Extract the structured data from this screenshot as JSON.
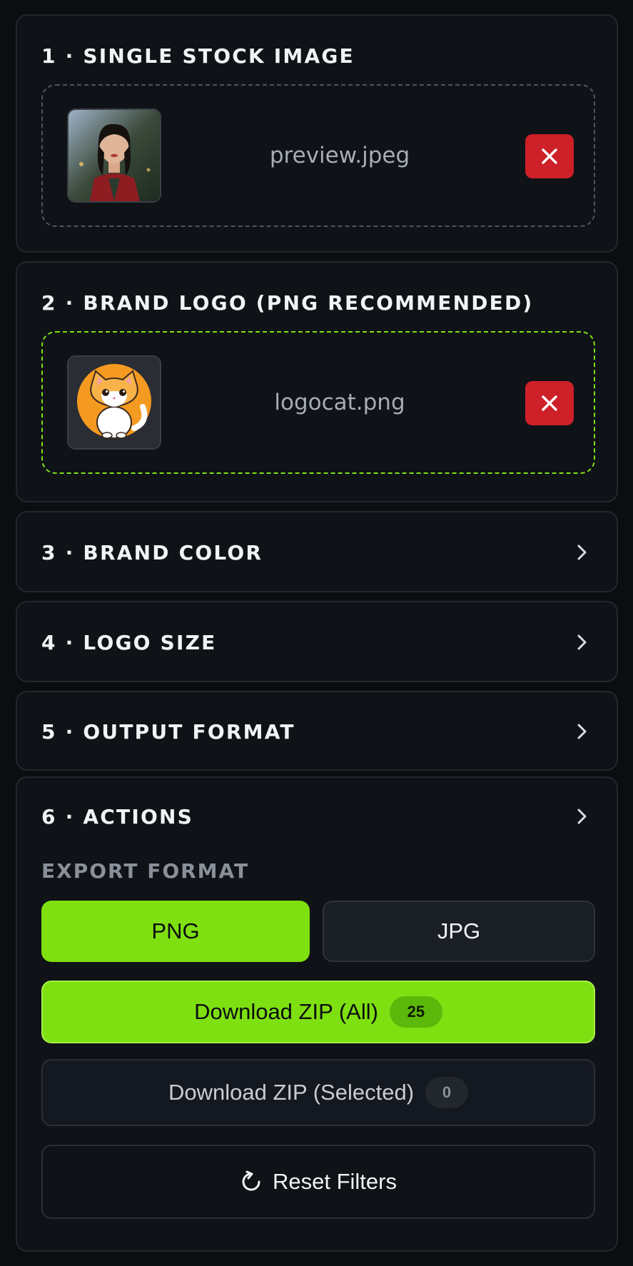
{
  "sections": {
    "s1": {
      "title": "1 · SINGLE STOCK IMAGE",
      "file_name": "preview.jpeg",
      "thumb_icon": "portrait-photo-thumbnail",
      "remove_icon": "close-icon"
    },
    "s2": {
      "title": "2 · BRAND LOGO (PNG RECOMMENDED)",
      "file_name": "logocat.png",
      "thumb_icon": "cat-logo-thumbnail",
      "remove_icon": "close-icon"
    },
    "s3": {
      "title": "3 · BRAND COLOR",
      "icon": "chevron-right-icon"
    },
    "s4": {
      "title": "4 · LOGO SIZE",
      "icon": "chevron-right-icon"
    },
    "s5": {
      "title": "5 · OUTPUT FORMAT",
      "icon": "chevron-right-icon"
    },
    "s6": {
      "title": "6 · ACTIONS",
      "icon": "chevron-right-icon",
      "export_label": "EXPORT FORMAT",
      "format_options": [
        "PNG",
        "JPG"
      ],
      "selected_format": "PNG",
      "download_all_label": "Download ZIP (All)",
      "download_all_count": "25",
      "download_selected_label": "Download ZIP (Selected)",
      "download_selected_count": "0",
      "reset_label": "Reset Filters",
      "reset_icon": "refresh-icon"
    }
  },
  "colors": {
    "accent": "#7ee010",
    "danger": "#cd2028",
    "background": "#0b0d11",
    "card": "#0f1217"
  }
}
